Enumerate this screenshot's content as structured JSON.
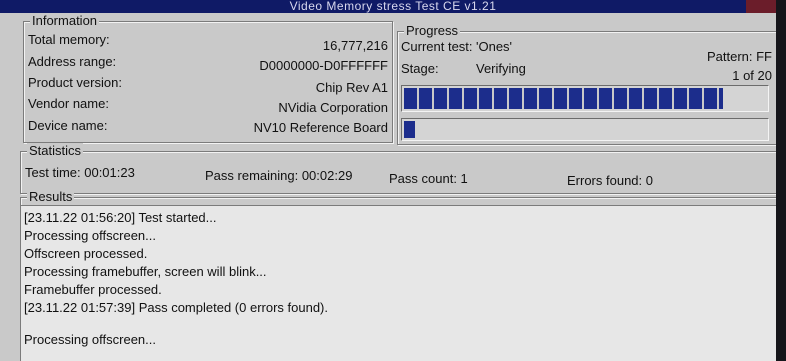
{
  "window": {
    "title": "Video Memory stress Test CE v1.21"
  },
  "information": {
    "legend": "Information",
    "rows": [
      {
        "label": "Total memory:",
        "value": "16,777,216"
      },
      {
        "label": "Address range:",
        "value": "D0000000-D0FFFFFF"
      },
      {
        "label": "Product version:",
        "value": "Chip Rev A1"
      },
      {
        "label": "Vendor name:",
        "value": "NVidia Corporation"
      },
      {
        "label": "Device name:",
        "value": "NV10 Reference Board"
      }
    ]
  },
  "progress": {
    "legend": "Progress",
    "current_test_label": "Current test:",
    "current_test_value": "'Ones'",
    "pattern_text": "Pattern: FF",
    "stage_label": "Stage:",
    "stage_value": "Verifying",
    "pass_of_text": "1 of 20",
    "stage_progress_fraction": 0.88,
    "overall_progress_fraction": 0.03
  },
  "statistics": {
    "legend": "Statistics",
    "test_time": "Test time:  00:01:23",
    "pass_remaining": "Pass remaining:  00:02:29",
    "pass_count": "Pass count:  1",
    "errors_found": "Errors found:  0"
  },
  "results": {
    "legend": "Results",
    "lines": [
      "[23.11.22 01:56:20] Test started...",
      "Processing offscreen...",
      "Offscreen processed.",
      "Processing framebuffer, screen will blink...",
      "Framebuffer processed.",
      "[23.11.22 01:57:39] Pass completed (0 errors found).",
      "",
      "Processing offscreen..."
    ]
  }
}
